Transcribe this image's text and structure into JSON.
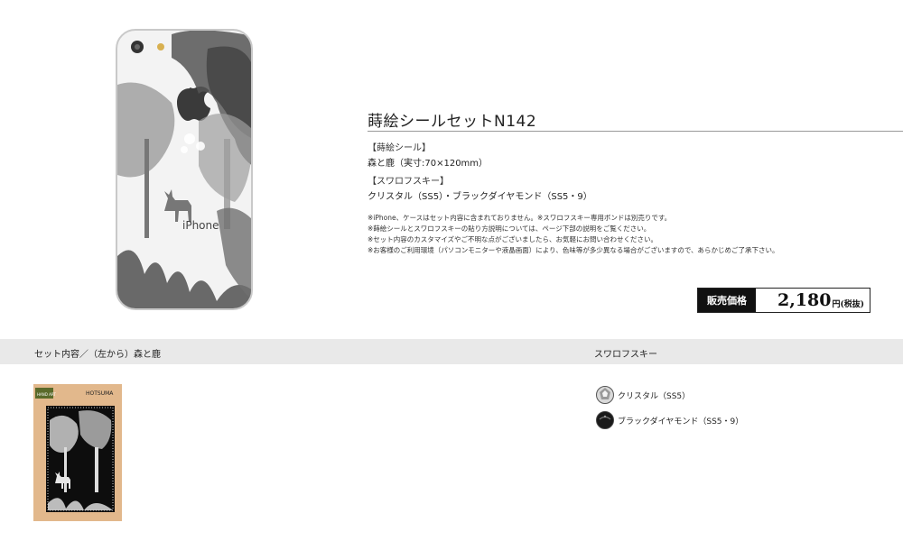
{
  "product": {
    "title": "蒔絵シールセットN142",
    "maki_head": "【蒔絵シール】",
    "maki_value": "森と鹿（実寸:70×120mm）",
    "swarovski_head": "【スワロフスキー】",
    "swarovski_value": "クリスタル（SS5）・ブラックダイヤモンド（SS5・9）",
    "notes": [
      "※iPhone、ケースはセット内容に含まれておりません。※スワロフスキー専用ボンドは別売りです。",
      "※蒔絵シールとスワロフスキーの貼り方説明については、ページ下部の説明をご覧ください。",
      "※セット内容のカスタマイズやご不明な点がございましたら、お気軽にお問い合わせください。",
      "※お客様のご利用環境（パソコンモニターや液晶画面）により、色味等が多少異なる場合がございますので、あらかじめご了承下さい。"
    ],
    "price_label": "販売価格",
    "price_value": "2,180",
    "price_unit": "円(税抜)"
  },
  "phone": {
    "brand_text": "iPhone"
  },
  "set_contents": {
    "heading": "セット内容／（左から）森と鹿",
    "package_tag": "HAND ART",
    "package_brand": "HOTSUMA"
  },
  "swarovski_section": {
    "heading": "スワロフスキー",
    "items": [
      {
        "label": "クリスタル（SS5）",
        "color": "#bdbdbd"
      },
      {
        "label": "ブラックダイヤモンド（SS5・9）",
        "color": "#1a1a1a"
      }
    ]
  },
  "colors": {
    "band": "#e9e9e9",
    "package": "#e2b88c",
    "price_label_bg": "#111111"
  }
}
